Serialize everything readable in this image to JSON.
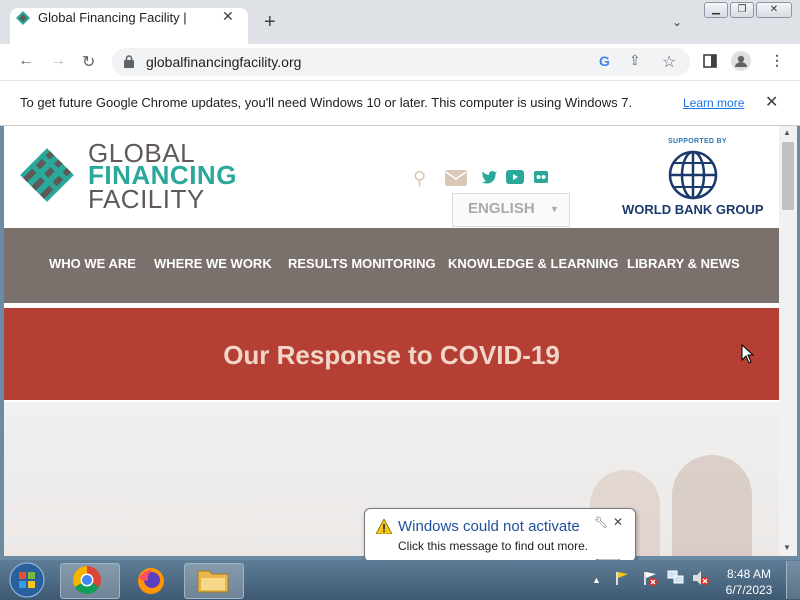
{
  "browser": {
    "tab_title": "Global Financing Facility |",
    "url": "globalfinancingfacility.org",
    "info_message": "To get future Google Chrome updates, you'll need Windows 10 or later. This computer is using Windows 7.",
    "learn_more": "Learn more"
  },
  "site": {
    "logo": {
      "line1": "GLOBAL",
      "line2": "FINANCING",
      "line3": "FACILITY"
    },
    "language": "ENGLISH",
    "supported_by": "SUPPORTED BY",
    "wb_name": "WORLD BANK GROUP",
    "nav": [
      "WHO WE ARE",
      "WHERE WE WORK",
      "RESULTS MONITORING",
      "KNOWLEDGE & LEARNING",
      "LIBRARY & NEWS"
    ],
    "banner_title": "Our Response to COVID-19"
  },
  "notification": {
    "title": "Windows could not activate",
    "subtitle": "Click this message to find out more."
  },
  "taskbar": {
    "time": "8:48 AM",
    "date": "6/7/2023"
  },
  "colors": {
    "nav_bg": "#7a716c",
    "banner_bg": "#b53f34",
    "logo_teal": "#2aa89a",
    "logo_gray": "#5f5a57"
  }
}
